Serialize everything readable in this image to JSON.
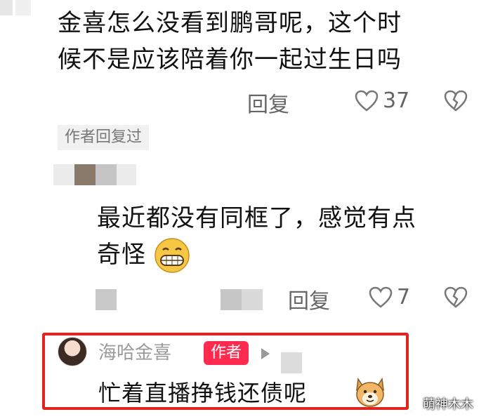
{
  "comment1": {
    "line1": "金喜怎么没看到鹏哥呢，这个时",
    "line2": "候不是应该陪着你一起过生日吗",
    "reply_label": "回复",
    "likes": "37"
  },
  "author_replied_label": "作者回复过",
  "comment2": {
    "line1": "最近都没有同框了，感觉有点",
    "line2": "奇怪",
    "reply_label": "回复",
    "likes": "7"
  },
  "reply": {
    "username": "海哈金喜",
    "badge": "作者",
    "text": "忙着直播挣钱还债呢"
  },
  "watermark": "萌神木木",
  "icons": {
    "like": "heart-outline-icon",
    "dislike": "broken-heart-icon",
    "emoji_grin": "grinning-face-icon",
    "emoji_dog": "dog-face-icon"
  },
  "colors": {
    "highlight_border": "#e0241f",
    "author_badge": "#ff2b4f"
  }
}
